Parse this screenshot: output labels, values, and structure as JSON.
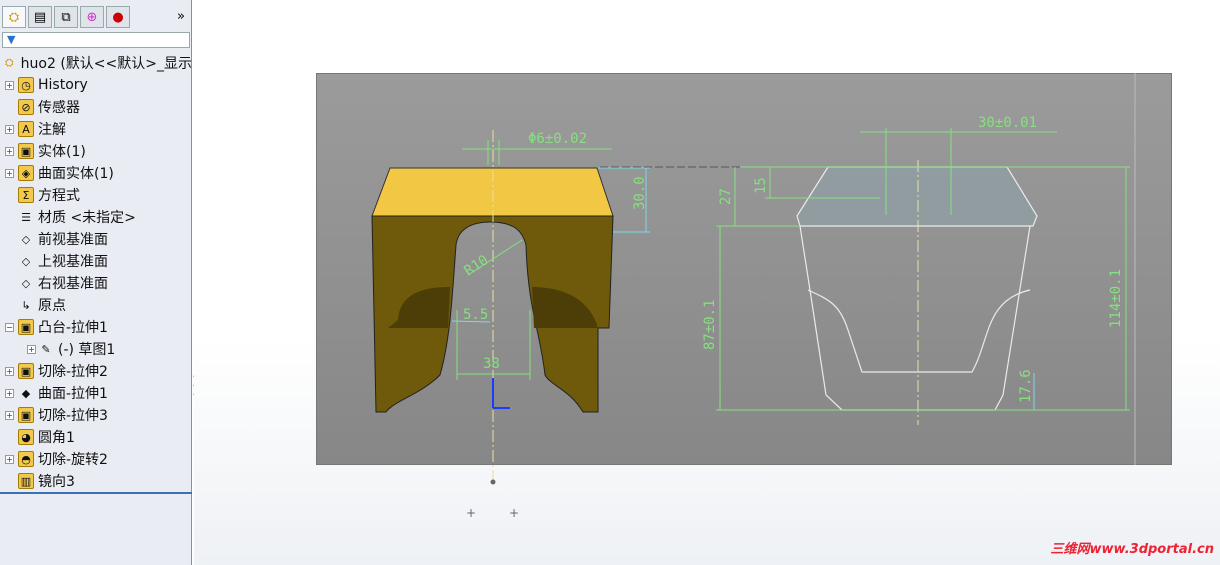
{
  "feature_manager": {
    "tabs": [
      "feature-manager",
      "property-manager",
      "configuration-manager",
      "dimxpert-manager",
      "display-manager"
    ],
    "more": "»",
    "filter_icon": "filter-icon",
    "root": "huo2  (默认<<默认>_显示",
    "items": [
      {
        "label": "History",
        "icon": "history-icon",
        "expand": true
      },
      {
        "label": "传感器",
        "icon": "sensor-icon",
        "expand": false
      },
      {
        "label": "注解",
        "icon": "annotation-icon",
        "expand": true
      },
      {
        "label": "实体(1)",
        "icon": "solid-body-icon",
        "expand": true
      },
      {
        "label": "曲面实体(1)",
        "icon": "surface-body-icon",
        "expand": true
      },
      {
        "label": "方程式",
        "icon": "equation-icon",
        "expand": false
      },
      {
        "label": "材质 <未指定>",
        "icon": "material-icon",
        "expand": false
      },
      {
        "label": "前视基准面",
        "icon": "plane-icon",
        "expand": false
      },
      {
        "label": "上视基准面",
        "icon": "plane-icon",
        "expand": false
      },
      {
        "label": "右视基准面",
        "icon": "plane-icon",
        "expand": false
      },
      {
        "label": "原点",
        "icon": "origin-icon",
        "expand": false
      },
      {
        "label": "凸台-拉伸1",
        "icon": "boss-extrude-icon",
        "expand": "open"
      },
      {
        "label": "(-) 草图1",
        "icon": "sketch-icon",
        "expand": true,
        "child": true
      },
      {
        "label": "切除-拉伸2",
        "icon": "cut-extrude-icon",
        "expand": true
      },
      {
        "label": "曲面-拉伸1",
        "icon": "surface-extrude-icon",
        "expand": true
      },
      {
        "label": "切除-拉伸3",
        "icon": "cut-extrude-icon",
        "expand": true
      },
      {
        "label": "圆角1",
        "icon": "fillet-icon",
        "expand": false
      },
      {
        "label": "切除-旋转2",
        "icon": "cut-revolve-icon",
        "expand": true
      },
      {
        "label": "镜向3",
        "icon": "mirror-icon",
        "expand": false
      }
    ]
  },
  "drawing": {
    "dims": {
      "phi": "Φ6±0.02",
      "d30": "30.0",
      "r10": "R10",
      "d55": "5.5",
      "d38": "38",
      "d30tol": "30±0.01",
      "d27": "27",
      "d15": "15",
      "d87": "87±0.1",
      "d114": "114±0.1",
      "d176": "17.6"
    },
    "colors": {
      "dimension": "#86e07f",
      "part_top": "#f2c744",
      "part_front": "#6e5a0a",
      "view_bg": "#8e8e8e"
    }
  },
  "watermark": "三维网www.3dportal.cn"
}
